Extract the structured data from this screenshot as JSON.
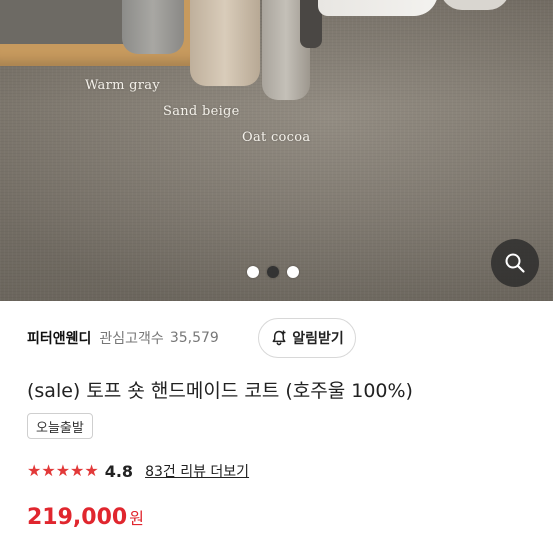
{
  "hero": {
    "labels": [
      "Warm gray",
      "Sand beige",
      "Oat cocoa"
    ],
    "slide_count": 3,
    "active_slide": 2
  },
  "seller": {
    "name": "피터앤웬디",
    "fav_label": "관심고객수",
    "fav_count": "35,579"
  },
  "notify": {
    "label": "알림받기",
    "icon": "bell-plus-icon"
  },
  "product": {
    "title": "(sale) 토프 숏 핸드메이드 코트 (호주울 100%)",
    "badge": "오늘출발",
    "rating": "4.8",
    "stars": 5,
    "review_link": "83건 리뷰 더보기",
    "price": "219,000",
    "currency": "원"
  },
  "colors": {
    "price_red": "#e0262e",
    "star_red": "#e23939"
  }
}
